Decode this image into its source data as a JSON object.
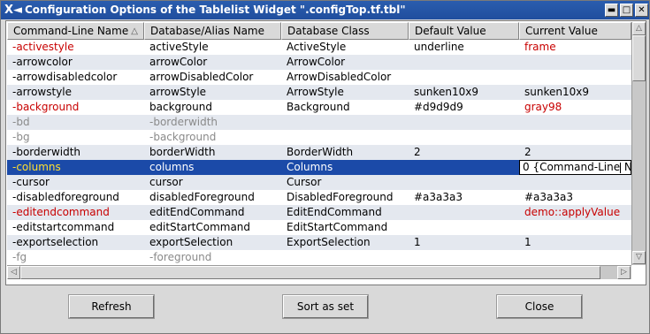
{
  "window": {
    "title": "Configuration Options of the Tablelist Widget \".configTop.tf.tbl\"",
    "sys_menu_glyph": "X◄",
    "min_glyph": "▬",
    "max_glyph": "□",
    "close_glyph": "✕"
  },
  "table": {
    "columns": [
      {
        "label": "Command-Line Name",
        "sort": "△"
      },
      {
        "label": "Database/Alias Name"
      },
      {
        "label": "Database Class"
      },
      {
        "label": "Default Value"
      },
      {
        "label": "Current Value"
      }
    ],
    "rows": [
      {
        "cells": [
          "-activestyle",
          "activeStyle",
          "ActiveStyle",
          "underline",
          "frame"
        ],
        "style": "changed"
      },
      {
        "cells": [
          "-arrowcolor",
          "arrowColor",
          "ArrowColor",
          "",
          ""
        ],
        "style": "normal"
      },
      {
        "cells": [
          "-arrowdisabledcolor",
          "arrowDisabledColor",
          "ArrowDisabledColor",
          "",
          ""
        ],
        "style": "normal"
      },
      {
        "cells": [
          "-arrowstyle",
          "arrowStyle",
          "ArrowStyle",
          "sunken10x9",
          "sunken10x9"
        ],
        "style": "normal"
      },
      {
        "cells": [
          "-background",
          "background",
          "Background",
          "#d9d9d9",
          "gray98"
        ],
        "style": "changed"
      },
      {
        "cells": [
          "-bd",
          "-borderwidth",
          "",
          "",
          ""
        ],
        "style": "alias"
      },
      {
        "cells": [
          "-bg",
          "-background",
          "",
          "",
          ""
        ],
        "style": "alias"
      },
      {
        "cells": [
          "-borderwidth",
          "borderWidth",
          "BorderWidth",
          "2",
          "2"
        ],
        "style": "normal"
      },
      {
        "cells": [
          "-columns",
          "columns",
          "Columns",
          "",
          ""
        ],
        "style": "selected",
        "editor_value": "0 {Command-Line",
        "editor_tail": " Na"
      },
      {
        "cells": [
          "-cursor",
          "cursor",
          "Cursor",
          "",
          ""
        ],
        "style": "normal"
      },
      {
        "cells": [
          "-disabledforeground",
          "disabledForeground",
          "DisabledForeground",
          "#a3a3a3",
          "#a3a3a3"
        ],
        "style": "normal"
      },
      {
        "cells": [
          "-editendcommand",
          "editEndCommand",
          "EditEndCommand",
          "",
          "demo::applyValue"
        ],
        "style": "changed"
      },
      {
        "cells": [
          "-editstartcommand",
          "editStartCommand",
          "EditStartCommand",
          "",
          ""
        ],
        "style": "normal"
      },
      {
        "cells": [
          "-exportselection",
          "exportSelection",
          "ExportSelection",
          "1",
          "1"
        ],
        "style": "normal"
      },
      {
        "cells": [
          "-fg",
          "-foreground",
          "",
          "",
          ""
        ],
        "style": "alias"
      }
    ]
  },
  "scrollbars": {
    "up_glyph": "△",
    "down_glyph": "▽",
    "left_glyph": "◁",
    "right_glyph": "▷"
  },
  "buttons": {
    "refresh": "Refresh",
    "sort": "Sort as set",
    "close": "Close"
  },
  "colors": {
    "changed_text": "#c80000",
    "alias_text": "#8a8a8a",
    "selection_bg": "#1b4aa8",
    "title_bg": "#2a5dae"
  }
}
